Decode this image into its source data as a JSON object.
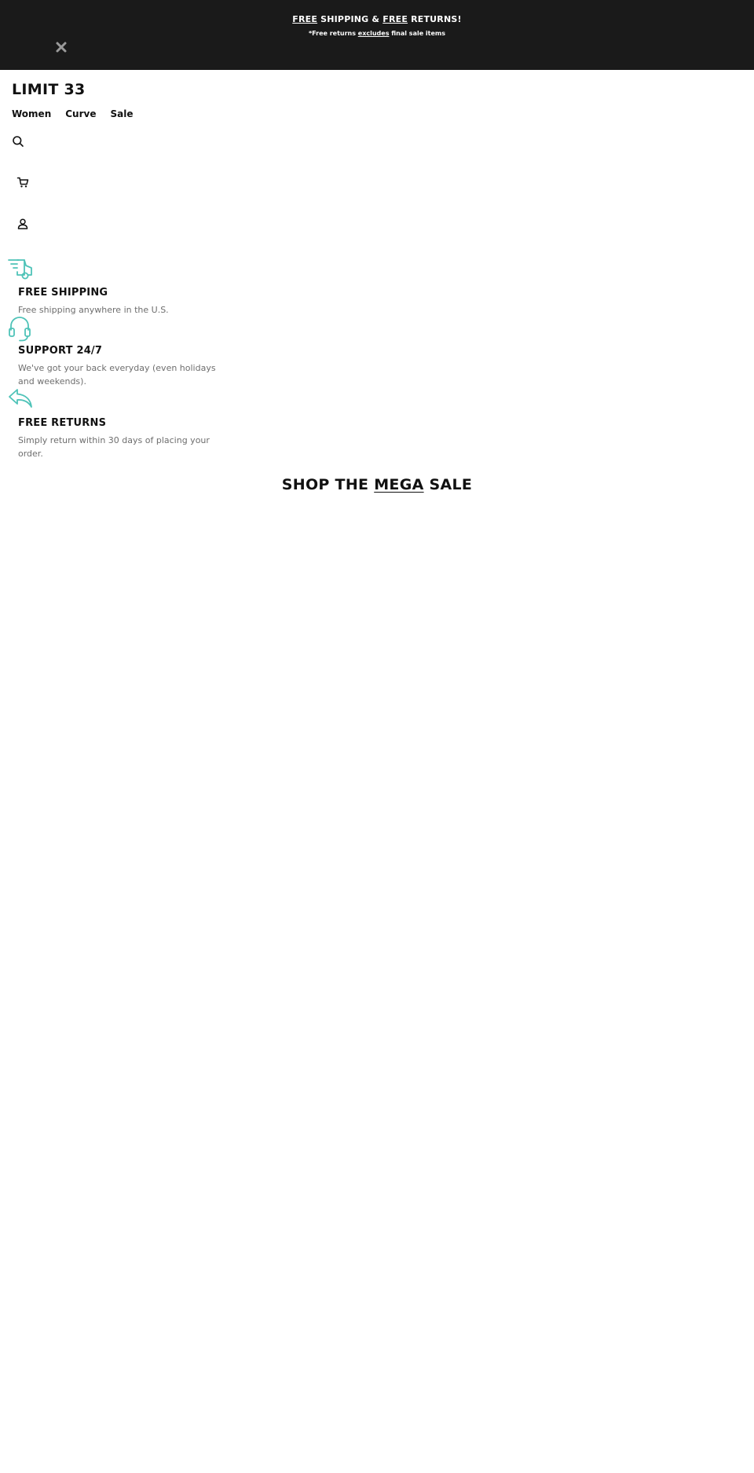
{
  "announcement": {
    "line1_free_a": "FREE",
    "line1_mid": " SHIPPING & ",
    "line1_free_b": "FREE",
    "line1_end": " RETURNS!",
    "line2_start": "*Free returns ",
    "line2_link": "excludes",
    "line2_end": " final sale items",
    "close_icon": "close-icon"
  },
  "header": {
    "logo": "LIMIT 33",
    "nav": [
      {
        "label": "Women"
      },
      {
        "label": "Curve"
      },
      {
        "label": "Sale"
      }
    ],
    "icons": [
      "search-icon",
      "cart-icon",
      "user-icon"
    ]
  },
  "benefits": [
    {
      "icon": "delivery-truck-icon",
      "title": "FREE SHIPPING",
      "text": "Free shipping anywhere in the U.S."
    },
    {
      "icon": "headset-icon",
      "title": "SUPPORT 24/7",
      "text": "We've got your back everyday (even holidays and weekends)."
    },
    {
      "icon": "return-arrow-icon",
      "title": "FREE RETURNS",
      "text": "Simply return within 30 days of placing your order."
    }
  ],
  "sale_section": {
    "title_start": "SHOP THE ",
    "title_highlight": "MEGA",
    "title_end": " SALE"
  },
  "colors": {
    "announcement_bg": "#1a1a1a",
    "accent_teal": "#4fc3b8",
    "muted_text": "#6e6e6e"
  }
}
